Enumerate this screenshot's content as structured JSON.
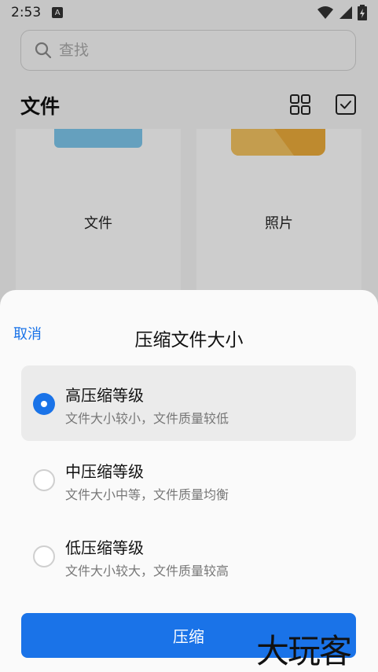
{
  "status_bar": {
    "time": "2:53",
    "notif_letter": "A"
  },
  "search": {
    "placeholder": "查找"
  },
  "header": {
    "title": "文件"
  },
  "cards": [
    {
      "label": "文件"
    },
    {
      "label": "照片"
    }
  ],
  "sheet": {
    "cancel": "取消",
    "title": "压缩文件大小",
    "options": [
      {
        "title": "高压缩等级",
        "desc": "文件大小较小，文件质量较低",
        "selected": true
      },
      {
        "title": "中压缩等级",
        "desc": "文件大小中等，文件质量均衡",
        "selected": false
      },
      {
        "title": "低压缩等级",
        "desc": "文件大小较大，文件质量较高",
        "selected": false
      }
    ],
    "confirm": "压缩"
  },
  "watermark": "大玩客",
  "colors": {
    "accent": "#1a73e8",
    "folder_blue": "#7cc4e8",
    "folder_yellow": "#e8a93a"
  }
}
